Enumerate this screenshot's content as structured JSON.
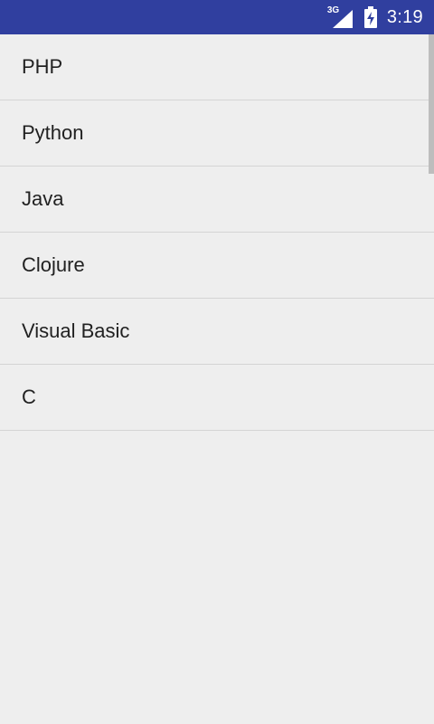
{
  "status_bar": {
    "network_type": "3G",
    "time": "3:19",
    "signal_icon": "cell-signal-icon",
    "battery_icon": "battery-charging-icon",
    "background": "#303f9f"
  },
  "list": {
    "items": [
      {
        "label": "PHP"
      },
      {
        "label": "Python"
      },
      {
        "label": "Java"
      },
      {
        "label": "Clojure"
      },
      {
        "label": "Visual Basic"
      },
      {
        "label": "C"
      }
    ]
  },
  "colors": {
    "background": "#eeeeee",
    "divider": "#d4d4d4",
    "text": "#212121"
  }
}
